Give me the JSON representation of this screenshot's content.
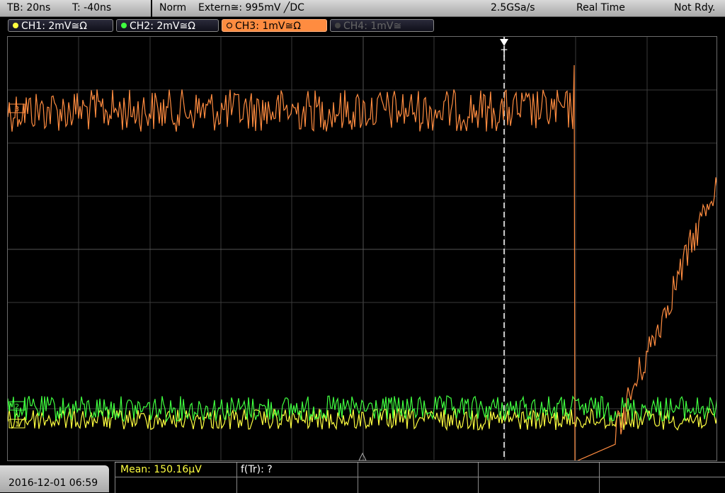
{
  "topbar": {
    "timebase": "TB: 20ns",
    "trigger_time": "T: -40ns",
    "mode": "Norm",
    "trigger_source": "Extern≅: 995mV ╱DC",
    "sample_rate": "2.5GSa/s",
    "acq_mode": "Real Time",
    "status": "Not Rdy."
  },
  "channels": [
    {
      "label": "CH1: 2mV≅Ω",
      "color": "#ffff40"
    },
    {
      "label": "CH2: 2mV≅Ω",
      "color": "#40ff40"
    },
    {
      "label": "CH3: 1mV≅Ω",
      "color": "#ff8c40"
    },
    {
      "label": "CH4: 1mV≅",
      "color": "#555555"
    }
  ],
  "markers": {
    "ch3": "3",
    "ch2": "2",
    "ch1": "1",
    "trigger": "T"
  },
  "bottom": {
    "datetime": "2016-12-01 06:59",
    "mean": "Mean: 150.16µV",
    "freq": "f(Tr): ?"
  },
  "colors": {
    "ch1": "#ffff40",
    "ch2": "#40ff40",
    "ch3": "#ff8c40",
    "grid": "#444444"
  }
}
